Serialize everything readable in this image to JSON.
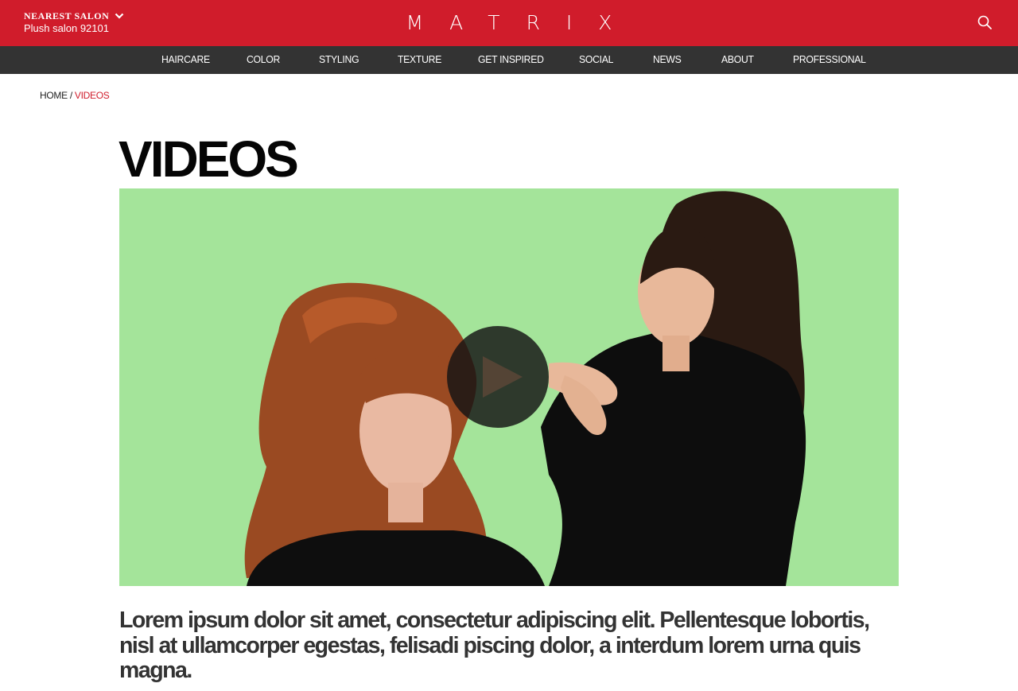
{
  "header": {
    "salon_title": "NEAREST SALON",
    "salon_name": "Plush salon 92101",
    "brand": "MATRIX",
    "brand_color": "#d01c2b"
  },
  "nav": {
    "items": [
      {
        "label": "HAIRCARE"
      },
      {
        "label": "COLOR"
      },
      {
        "label": "STYLING"
      },
      {
        "label": "TEXTURE"
      },
      {
        "label": "GET INSPIRED"
      },
      {
        "label": "SOCIAL"
      },
      {
        "label": "NEWS"
      },
      {
        "label": "ABOUT"
      },
      {
        "label": "PROFESSIONAL"
      }
    ],
    "background": "#333333"
  },
  "breadcrumb": {
    "home": "HOME",
    "separator": " / ",
    "current": "VIDEOS"
  },
  "page": {
    "title": "VIDEOS",
    "description": "Lorem ipsum dolor sit amet, consectetur adipiscing elit. Pellentesque lobortis, nisl at ullamcorper egestas, felisadi piscing dolor, a interdum lorem urna quis magna."
  },
  "video": {
    "background_color": "#a4e49a",
    "play_icon": "play-icon"
  },
  "icons": {
    "search": "search-icon",
    "chevron": "chevron-down-icon"
  }
}
